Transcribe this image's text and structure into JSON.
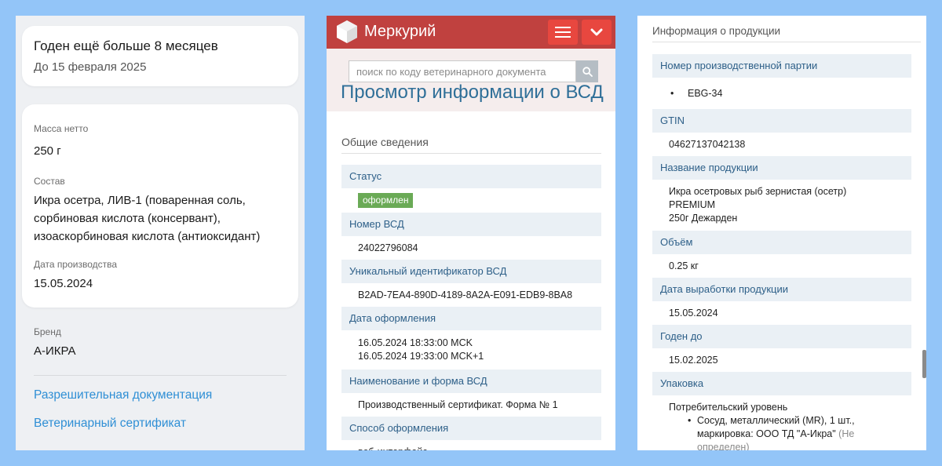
{
  "panel1": {
    "validity": {
      "title": "Годен ещё больше 8 месяцев",
      "until": "До 15 февраля 2025"
    },
    "specs": [
      {
        "label": "Масса нетто",
        "value": "250 г"
      },
      {
        "label": "Состав",
        "value_lines": [
          "Икра осетра, ЛИВ-1 (поваренная соль,",
          "сорбиновая кислота (консервант),",
          "изоаскорбиновая кислота (антиоксидант)"
        ]
      },
      {
        "label": "Дата производства",
        "value": "15.05.2024"
      }
    ],
    "brand": {
      "label": "Бренд",
      "value": "А-ИКРА"
    },
    "links": [
      "Разрешительная документация",
      "Ветеринарный сертификат"
    ]
  },
  "panel2": {
    "app_title": "Меркурий",
    "search_placeholder": "поиск по коду ветеринарного документа",
    "page_title": "Просмотр информации о ВСД",
    "section_title": "Общие сведения",
    "rows": [
      {
        "label": "Статус",
        "badge": "оформлен"
      },
      {
        "label": "Номер ВСД",
        "value": "24022796084"
      },
      {
        "label": "Уникальный идентификатор ВСД",
        "value": "B2AD-7EA4-890D-4189-8A2A-E091-EDB9-8BA8"
      },
      {
        "label": "Дата оформления",
        "lines": [
          "16.05.2024 18:33:00 MCK",
          "16.05.2024 19:33:00 MCK+1"
        ]
      },
      {
        "label": "Наименование и форма ВСД",
        "value": "Производственный сертификат. Форма № 1"
      },
      {
        "label": "Способ оформления",
        "value": "веб-интерфейс"
      }
    ],
    "colors": {
      "topbar": "#c0413f",
      "button": "#e8473f",
      "badge": "#6aaa56"
    }
  },
  "panel3": {
    "section_title": "Информация о продукции",
    "rows": [
      {
        "label": "Номер производственной партии",
        "bullet": "EBG-34"
      },
      {
        "label": "GTIN",
        "value": "04627137042138"
      },
      {
        "label": "Название продукции",
        "lines": [
          "Икра осетровых рыб зернистая (осетр) PREMIUM",
          "250г Дежарден"
        ]
      },
      {
        "label": "Объём",
        "value": "0.25 кг"
      },
      {
        "label": "Дата выработки продукции",
        "value": "15.05.2024"
      },
      {
        "label": "Годен до",
        "value": "15.02.2025"
      },
      {
        "label": "Упаковка",
        "level": "Потребительский уровень",
        "pack_lines": [
          "Сосуд, металлический (MR), 1 шт.,",
          "маркировка: ООО ТД \"А-Икра\""
        ],
        "pack_tail": "(Не",
        "pack_tail2": "определен)"
      }
    ]
  }
}
